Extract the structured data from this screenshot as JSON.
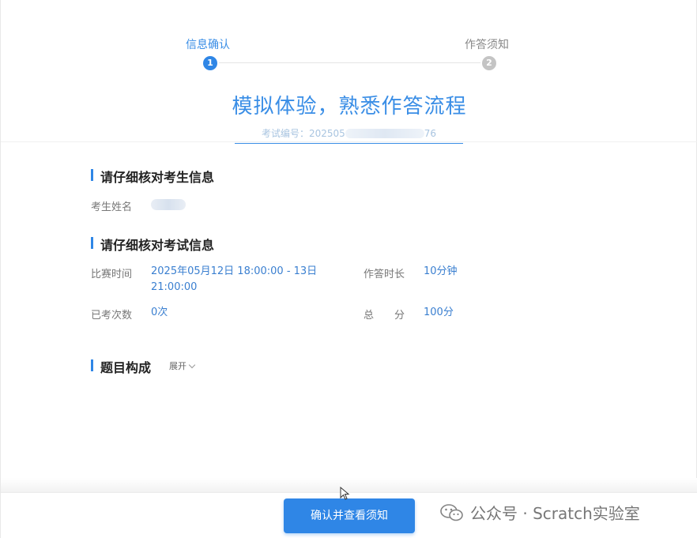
{
  "steps": [
    {
      "label": "信息确认",
      "number": "1",
      "state": "active"
    },
    {
      "label": "作答须知",
      "number": "2",
      "state": "todo"
    }
  ],
  "title": "模拟体验，熟悉作答流程",
  "exam_no": {
    "prefix": "考试编号：202505",
    "suffix": "76"
  },
  "candidate_section": {
    "title": "请仔细核对考生信息",
    "name_label": "考生姓名"
  },
  "exam_section": {
    "title": "请仔细核对考试信息",
    "time_label": "比赛时间",
    "time_value_line1": "2025年05月12日 18:00:00 - 13日",
    "time_value_line2": "21:00:00",
    "duration_label": "作答时长",
    "duration_value": "10分钟",
    "attempts_label": "已考次数",
    "attempts_value": "0次",
    "score_label": "总　　分",
    "score_value": "100分"
  },
  "structure_section": {
    "title": "题目构成",
    "expand_label": "展开"
  },
  "confirm_button": "确认并查看须知",
  "watermark": "公众号 · Scratch实验室",
  "colors": {
    "accent": "#2f86e6",
    "inactive": "#c4c4c4"
  },
  "icons": {
    "expand": "chevron-down-icon",
    "cursor": "mouse-pointer-icon",
    "watermark": "wechat-icon"
  }
}
